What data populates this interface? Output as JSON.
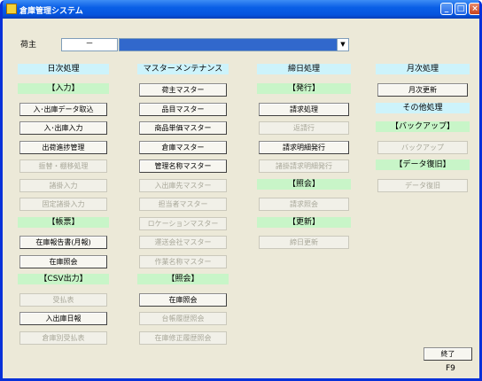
{
  "window": {
    "title": "倉庫管理システム"
  },
  "merchant": {
    "label": "荷主",
    "code": "－"
  },
  "columns": [
    {
      "header": "日次処理",
      "items": [
        {
          "type": "sub",
          "label": "【入力】"
        },
        {
          "type": "button",
          "label": "入･出庫データ取込",
          "enabled": true
        },
        {
          "type": "button",
          "label": "入･出庫入力",
          "enabled": true
        },
        {
          "type": "button",
          "label": "出荷進捗管理",
          "enabled": true
        },
        {
          "type": "button",
          "label": "振替・棚移処理",
          "enabled": false
        },
        {
          "type": "button",
          "label": "諸掛入力",
          "enabled": false
        },
        {
          "type": "button",
          "label": "固定諸掛入力",
          "enabled": false
        },
        {
          "type": "sub",
          "label": "【帳票】"
        },
        {
          "type": "button",
          "label": "在庫報告書(月報)",
          "enabled": true
        },
        {
          "type": "button",
          "label": "在庫照会",
          "enabled": true
        },
        {
          "type": "sub",
          "label": "【CSV出力】"
        },
        {
          "type": "button",
          "label": "受払表",
          "enabled": false
        },
        {
          "type": "button",
          "label": "入出庫日報",
          "enabled": true
        },
        {
          "type": "button",
          "label": "倉庫別受払表",
          "enabled": false
        }
      ]
    },
    {
      "header": "マスターメンテナンス",
      "items": [
        {
          "type": "button",
          "label": "荷主マスター",
          "enabled": true
        },
        {
          "type": "button",
          "label": "品目マスター",
          "enabled": true
        },
        {
          "type": "button",
          "label": "商品単価マスター",
          "enabled": true
        },
        {
          "type": "button",
          "label": "倉庫マスター",
          "enabled": true
        },
        {
          "type": "button",
          "label": "管理名称マスター",
          "enabled": true
        },
        {
          "type": "button",
          "label": "入出庫先マスター",
          "enabled": false
        },
        {
          "type": "button",
          "label": "担当者マスター",
          "enabled": false
        },
        {
          "type": "button",
          "label": "ロケーションマスター",
          "enabled": false
        },
        {
          "type": "button",
          "label": "運送会社マスター",
          "enabled": false
        },
        {
          "type": "button",
          "label": "作業名称マスター",
          "enabled": false
        },
        {
          "type": "sub",
          "label": "【照会】"
        },
        {
          "type": "button",
          "label": "在庫照会",
          "enabled": true
        },
        {
          "type": "button",
          "label": "台帳履歴照会",
          "enabled": false
        },
        {
          "type": "button",
          "label": "在庫修正履歴照会",
          "enabled": false
        }
      ]
    },
    {
      "header": "締日処理",
      "items": [
        {
          "type": "sub",
          "label": "【発行】"
        },
        {
          "type": "button",
          "label": "請求処理",
          "enabled": true
        },
        {
          "type": "button",
          "label": "返請行",
          "enabled": false
        },
        {
          "type": "button",
          "label": "請求明細発行",
          "enabled": true
        },
        {
          "type": "button",
          "label": "諸掛請求明細発行",
          "enabled": false
        },
        {
          "type": "sub",
          "label": "【照会】"
        },
        {
          "type": "button",
          "label": "請求照会",
          "enabled": false
        },
        {
          "type": "sub",
          "label": "【更新】"
        },
        {
          "type": "button",
          "label": "締日更新",
          "enabled": false
        }
      ]
    },
    {
      "header": "月次処理",
      "items": [
        {
          "type": "button",
          "label": "月次更新",
          "enabled": true
        },
        {
          "type": "header",
          "label": "その他処理"
        },
        {
          "type": "sub",
          "label": "【バックアップ】"
        },
        {
          "type": "button",
          "label": "バックアップ",
          "enabled": false
        },
        {
          "type": "sub",
          "label": "【データ復旧】"
        },
        {
          "type": "button",
          "label": "データ復旧",
          "enabled": false
        }
      ]
    }
  ],
  "exit": {
    "label": "終了",
    "shortcut": "F9"
  }
}
